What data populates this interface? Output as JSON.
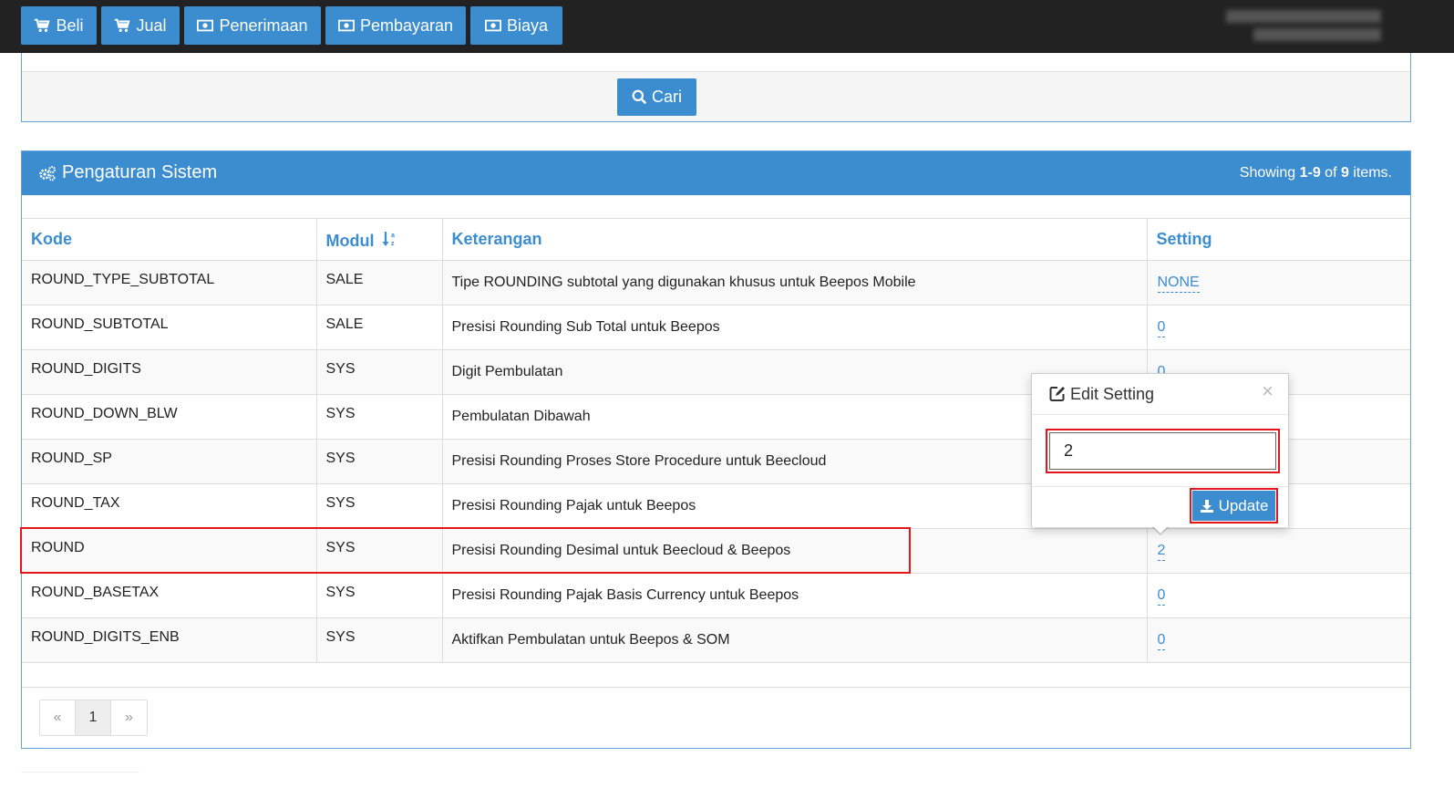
{
  "topbar": {
    "buttons": [
      {
        "label": "Beli",
        "icon": "cart-icon"
      },
      {
        "label": "Jual",
        "icon": "cart-icon"
      },
      {
        "label": "Penerimaan",
        "icon": "money-icon"
      },
      {
        "label": "Pembayaran",
        "icon": "money-icon"
      },
      {
        "label": "Biaya",
        "icon": "money-icon"
      }
    ]
  },
  "search": {
    "button_label": "Cari"
  },
  "panel": {
    "title": "Pengaturan Sistem",
    "summary_prefix": "Showing ",
    "summary_range": "1-9",
    "summary_of": " of ",
    "summary_total": "9",
    "summary_suffix": " items."
  },
  "table": {
    "headers": {
      "kode": "Kode",
      "modul": "Modul",
      "keterangan": "Keterangan",
      "setting": "Setting"
    },
    "rows": [
      {
        "kode": "ROUND_TYPE_SUBTOTAL",
        "modul": "SALE",
        "keterangan": "Tipe ROUNDING subtotal yang digunakan khusus untuk Beepos Mobile",
        "setting": "NONE"
      },
      {
        "kode": "ROUND_SUBTOTAL",
        "modul": "SALE",
        "keterangan": "Presisi Rounding Sub Total untuk Beepos",
        "setting": "0"
      },
      {
        "kode": "ROUND_DIGITS",
        "modul": "SYS",
        "keterangan": "Digit Pembulatan",
        "setting": "0"
      },
      {
        "kode": "ROUND_DOWN_BLW",
        "modul": "SYS",
        "keterangan": "Pembulatan Dibawah",
        "setting": ""
      },
      {
        "kode": "ROUND_SP",
        "modul": "SYS",
        "keterangan": "Presisi Rounding Proses Store Procedure untuk Beecloud",
        "setting": ""
      },
      {
        "kode": "ROUND_TAX",
        "modul": "SYS",
        "keterangan": "Presisi Rounding Pajak untuk Beepos",
        "setting": ""
      },
      {
        "kode": "ROUND",
        "modul": "SYS",
        "keterangan": "Presisi Rounding Desimal untuk Beecloud & Beepos",
        "setting": "2"
      },
      {
        "kode": "ROUND_BASETAX",
        "modul": "SYS",
        "keterangan": "Presisi Rounding Pajak Basis Currency untuk Beepos",
        "setting": "0"
      },
      {
        "kode": "ROUND_DIGITS_ENB",
        "modul": "SYS",
        "keterangan": "Aktifkan Pembulatan untuk Beepos & SOM",
        "setting": "0"
      }
    ]
  },
  "pagination": {
    "prev": "«",
    "page": "1",
    "next": "»"
  },
  "popover": {
    "title": "Edit Setting",
    "close": "×",
    "input_value": "2",
    "update_label": "Update"
  },
  "colors": {
    "primary": "#3c8dd0",
    "highlight": "#e3161c",
    "topbar": "#222222"
  }
}
